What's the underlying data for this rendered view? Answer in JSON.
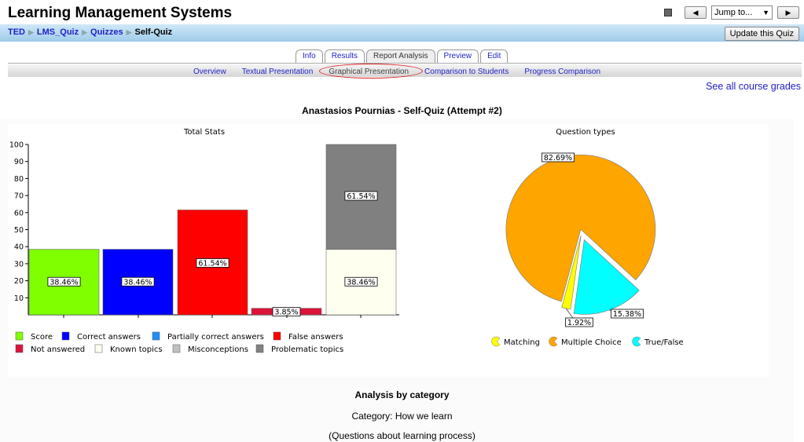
{
  "header": {
    "site_title": "Learning Management Systems",
    "jump_label": "Jump to...",
    "update_button": "Update this Quiz",
    "prev_icon": "prev-arrow-icon",
    "next_icon": "next-arrow-icon"
  },
  "breadcrumbs": [
    "TED",
    "LMS_Quiz",
    "Quizzes",
    "Self-Quiz"
  ],
  "tabs": [
    "Info",
    "Results",
    "Report Analysis",
    "Preview",
    "Edit"
  ],
  "subtabs": [
    "Overview",
    "Textual Presentation",
    "Graphical Presentation",
    "Comparison to Students",
    "Progress Comparison"
  ],
  "see_all_grades": "See all course grades",
  "attempt_title": "Anastasios Pournias - Self-Quiz (Attempt #2)",
  "analysis": {
    "title": "Analysis by category",
    "category": "Category: How we learn",
    "description": "(Questions about learning process)"
  },
  "colors": {
    "link": "#1e1ec8",
    "score": "#7fff00",
    "correct": "#0000ff",
    "partial": "#1e90ff",
    "false": "#ff0000",
    "not_answered": "#dc143c",
    "known": "#fffff0",
    "misconceptions": "#c0c0c0",
    "problematic": "#808080",
    "matching": "#ffff00",
    "multiple_choice": "#ffa500",
    "true_false": "#00ffff"
  },
  "chart_data": [
    {
      "type": "bar",
      "title": "Total Stats",
      "ylim": [
        0,
        100
      ],
      "yticks": [
        10,
        20,
        30,
        40,
        50,
        60,
        70,
        80,
        90,
        100
      ],
      "bars": [
        {
          "name": "Score",
          "value": 38.46,
          "label": "38.46%"
        },
        {
          "name": "Correct answers",
          "value": 38.46,
          "label": "38.46%"
        },
        {
          "name": "False answers",
          "value": 61.54,
          "label": "61.54%"
        },
        {
          "name": "Not answered",
          "value": 3.85,
          "label": "3.85%"
        }
      ],
      "stacked_bar": [
        {
          "name": "Known topics",
          "value": 38.46,
          "label": "38.46%"
        },
        {
          "name": "Problematic topics",
          "value": 61.54,
          "label": "61.54%"
        }
      ],
      "legend": [
        "Score",
        "Correct answers",
        "Partially correct answers",
        "False answers",
        "Not answered",
        "Known topics",
        "Misconceptions",
        "Problematic topics"
      ]
    },
    {
      "type": "pie",
      "title": "Question types",
      "slices": [
        {
          "name": "Matching",
          "value": 1.92,
          "label": "1.92%"
        },
        {
          "name": "Multiple Choice",
          "value": 82.69,
          "label": "82.69%"
        },
        {
          "name": "True/False",
          "value": 15.38,
          "label": "15.38%"
        }
      ],
      "legend": [
        "Matching",
        "Multiple Choice",
        "True/False"
      ]
    }
  ]
}
